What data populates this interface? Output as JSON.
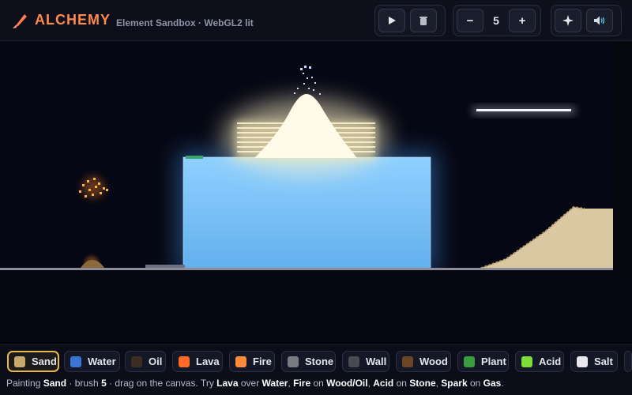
{
  "header": {
    "title": "ALCHEMY",
    "subtitle": "Element Sandbox · WebGL2 lit",
    "brush_size": "5",
    "minus_label": "−",
    "plus_label": "+",
    "play_icon": "play-icon",
    "clear_icon": "trash-icon",
    "glow_icon": "sparkle-icon",
    "sound_icon": "speaker-icon"
  },
  "palette": [
    {
      "label": "Sand",
      "color": "#c8a96a",
      "active": true
    },
    {
      "label": "Water",
      "color": "#3b73d6"
    },
    {
      "label": "Oil",
      "color": "#3b2d22"
    },
    {
      "label": "Lava",
      "color": "#ff6a2a"
    },
    {
      "label": "Fire",
      "color": "#ff8a3c"
    },
    {
      "label": "Stone",
      "color": "#7a7b82"
    },
    {
      "label": "Wall",
      "color": "#4a4b52"
    },
    {
      "label": "Wood",
      "color": "#6a4526"
    },
    {
      "label": "Plant",
      "color": "#3a9c3e"
    },
    {
      "label": "Acid",
      "color": "#7ddc3a"
    },
    {
      "label": "Salt",
      "color": "#e8e8ee"
    }
  ],
  "status": {
    "p1": "Painting ",
    "element": "Sand",
    "p2": " · brush ",
    "brush": "5",
    "p3": " · drag on the canvas. Try ",
    "a1": "Lava",
    "p4": " over ",
    "b1": "Water",
    "p5": ", ",
    "a2": "Fire",
    "p6": " on ",
    "b2": "Wood/Oil",
    "p7": ", ",
    "a3": "Acid",
    "p8": " on ",
    "b3": "Stone",
    "p9": ", ",
    "a4": "Spark",
    "p10": " on ",
    "b4": "Gas",
    "p11": "."
  }
}
